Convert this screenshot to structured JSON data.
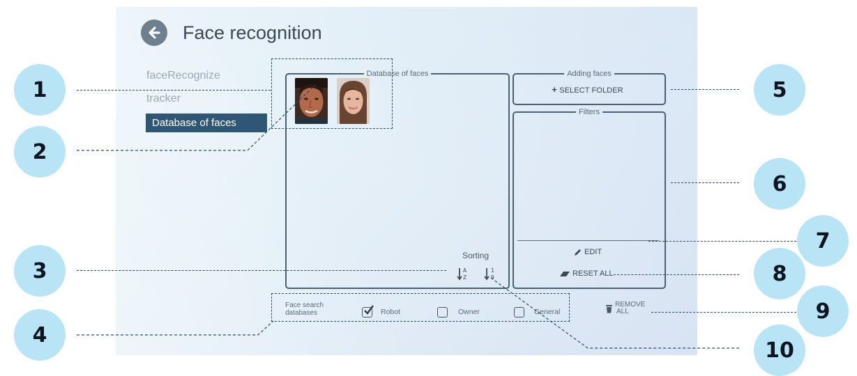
{
  "app": {
    "title": "Face recognition",
    "nav": [
      {
        "label": "faceRecognize",
        "active": false
      },
      {
        "label": "tracker",
        "active": false
      },
      {
        "label": "Database of faces",
        "active": true
      }
    ],
    "database_panel": {
      "legend": "Database of faces",
      "faces": [
        {
          "name": "face-thumbnail-man"
        },
        {
          "name": "face-thumbnail-woman"
        }
      ],
      "sorting_label": "Sorting",
      "sort_alpha_icon": "sort-alpha-icon",
      "sort_numeric_icon": "sort-numeric-icon"
    },
    "adding_panel": {
      "legend": "Adding faces",
      "select_folder": "SELECT FOLDER",
      "plus_icon": "plus-icon"
    },
    "filters_panel": {
      "legend": "Filters",
      "edit": "EDIT",
      "reset_all": "RESET ALL",
      "pencil_icon": "pencil-icon",
      "eraser_icon": "eraser-icon"
    },
    "search_databases": {
      "label_line1": "Face search",
      "label_line2": "databases",
      "options": [
        {
          "label": "Robot",
          "checked": true
        },
        {
          "label": "Owner",
          "checked": false
        },
        {
          "label": "General",
          "checked": false
        }
      ]
    },
    "remove_all": {
      "line1": "REMOVE",
      "line2": "ALL",
      "icon": "trash-icon"
    }
  },
  "callouts": [
    "1",
    "2",
    "3",
    "4",
    "5",
    "6",
    "7",
    "8",
    "9",
    "10"
  ],
  "colors": {
    "active_nav_bg": "#2f5775",
    "callout_bg": "#b9e4f5",
    "panel_border": "#4d6071"
  }
}
